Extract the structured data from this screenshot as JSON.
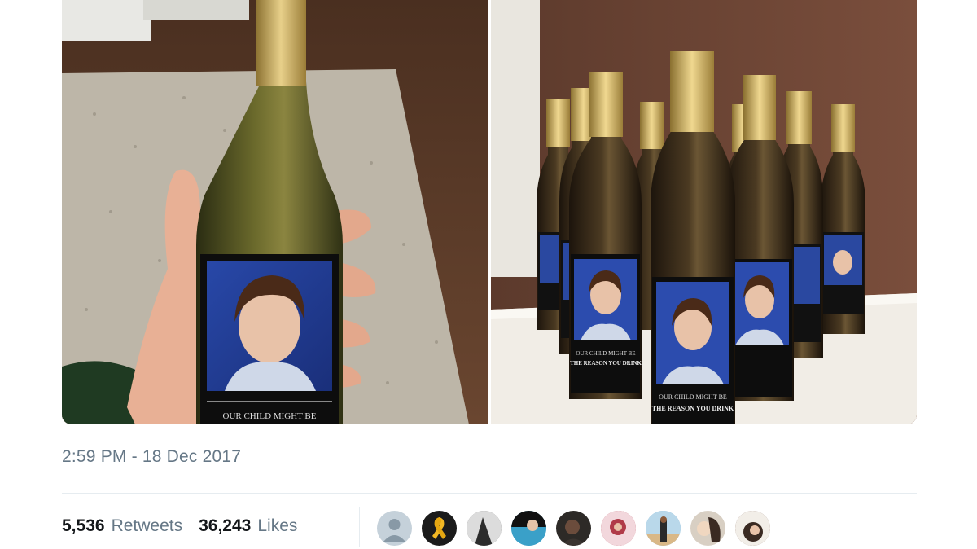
{
  "tweet": {
    "timestamp": "2:59 PM - 18 Dec 2017",
    "retweets_count": "5,536",
    "retweets_label": "Retweets",
    "likes_count": "36,243",
    "likes_label": "Likes"
  },
  "media": {
    "label_text": [
      "OUR CHILD MIGHT BE",
      "THE REASON YOU DRINK"
    ]
  },
  "avatars": [
    {
      "name": "default-avatar",
      "color": "#c5d1da"
    },
    {
      "name": "yellow-ribbon-avatar",
      "color": "#1b1b1b"
    },
    {
      "name": "avatar-3",
      "color": "#5b5b5b"
    },
    {
      "name": "avatar-4",
      "color": "#3aa0c8"
    },
    {
      "name": "avatar-5",
      "color": "#2d2a27"
    },
    {
      "name": "avatar-6",
      "color": "#b03a48"
    },
    {
      "name": "avatar-7",
      "color": "#7bb3d6"
    },
    {
      "name": "avatar-8",
      "color": "#d8cfc3"
    },
    {
      "name": "avatar-9",
      "color": "#6a4a3c"
    }
  ]
}
